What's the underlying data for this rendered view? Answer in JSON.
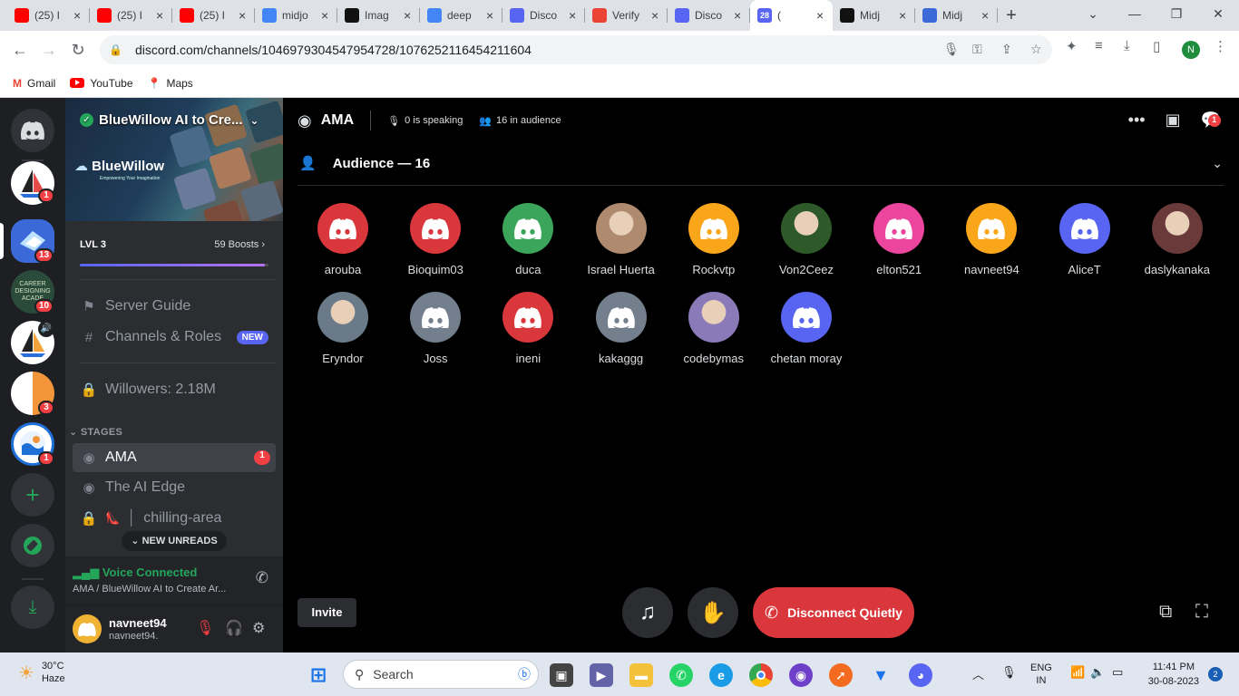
{
  "browser": {
    "tabs": [
      {
        "title": "(25) I",
        "icon": "youtube-icon",
        "color": "#ff0000"
      },
      {
        "title": "(25) I",
        "icon": "youtube-icon",
        "color": "#ff0000"
      },
      {
        "title": "(25) I",
        "icon": "youtube-icon",
        "color": "#ff0000"
      },
      {
        "title": "midjo",
        "icon": "google-icon",
        "color": "#4285f4"
      },
      {
        "title": "Imag",
        "icon": "image-site-icon",
        "color": "#111111"
      },
      {
        "title": "deep",
        "icon": "google-icon",
        "color": "#4285f4"
      },
      {
        "title": "Disco",
        "icon": "discord-icon",
        "color": "#5865f2"
      },
      {
        "title": "Verify",
        "icon": "gmail-icon",
        "color": "#ea4335"
      },
      {
        "title": "Disco",
        "icon": "discord-icon",
        "color": "#5865f2"
      },
      {
        "title": "(",
        "icon": "discord-icon",
        "color": "#5865f2",
        "active": true,
        "badge": "28"
      },
      {
        "title": "Midj",
        "icon": "midjourney-icon",
        "color": "#111111"
      },
      {
        "title": "Midj",
        "icon": "midjourney-icon",
        "color": "#3b6ad8"
      }
    ],
    "url": "discord.com/channels/1046979304547954728/1076252116454211604",
    "profile_initial": "N",
    "bookmarks": [
      {
        "label": "Gmail",
        "icon": "gmail-icon"
      },
      {
        "label": "YouTube",
        "icon": "youtube-icon"
      },
      {
        "label": "Maps",
        "icon": "maps-icon"
      }
    ]
  },
  "rail": {
    "servers": [
      {
        "name": "home",
        "badge": ""
      },
      {
        "name": "sailboat-server",
        "badge": "1"
      },
      {
        "name": "bluewillow-server",
        "badge": "13",
        "active": true
      },
      {
        "name": "career-designing-academy",
        "badge": "10",
        "text": "CAREER DESIGNING ACADE"
      },
      {
        "name": "sailboat-server-2",
        "badge": ""
      },
      {
        "name": "orange-server",
        "badge": "3"
      },
      {
        "name": "wave-server",
        "badge": "1"
      }
    ]
  },
  "server": {
    "name": "BlueWillow AI to Cre...",
    "logo_text": "BlueWillow",
    "logo_sub": "Empowering Your Imagination",
    "level": "LVL 3",
    "boosts": "59 Boosts",
    "boost_progress": 0.98,
    "server_guide": "Server Guide",
    "channels_roles": "Channels & Roles",
    "new_tag": "NEW",
    "willowers": "Willowers: 2.18M",
    "category": "STAGES",
    "channels": [
      {
        "name": "AMA",
        "badge": "1",
        "active": true
      },
      {
        "name": "The AI Edge"
      },
      {
        "name": "chilling-area"
      }
    ],
    "new_unreads": "NEW UNREADS"
  },
  "voice": {
    "status": "Voice Connected",
    "location": "AMA / BlueWillow AI to Create Ar..."
  },
  "user": {
    "name": "navneet94",
    "tag": "navneet94."
  },
  "stage": {
    "title": "AMA",
    "speaking": "0 is speaking",
    "audience_count": "16 in audience",
    "audience_header": "Audience — 16",
    "members": [
      {
        "name": "arouba",
        "color": "#da373c"
      },
      {
        "name": "Bioquim03",
        "color": "#da373c"
      },
      {
        "name": "duca",
        "color": "#3ba55c"
      },
      {
        "name": "Israel Huerta",
        "color": "#b08a6e",
        "photo": true
      },
      {
        "name": "Rockvtp",
        "color": "#faa61a"
      },
      {
        "name": "Von2Ceez",
        "color": "#2e5a2a",
        "photo": true
      },
      {
        "name": "elton521",
        "color": "#eb459e"
      },
      {
        "name": "navneet94",
        "color": "#faa61a"
      },
      {
        "name": "AliceT",
        "color": "#5865f2"
      },
      {
        "name": "daslykanaka",
        "color": "#6a3a3a",
        "photo": true
      },
      {
        "name": "Eryndor",
        "color": "#6a7a88",
        "photo": true
      },
      {
        "name": "Joss",
        "color": "#747f8d"
      },
      {
        "name": "ineni",
        "color": "#da373c"
      },
      {
        "name": "kakaggg",
        "color": "#747f8d"
      },
      {
        "name": "codebymas",
        "color": "#8a7ab8",
        "photo": true
      },
      {
        "name": "chetan moray",
        "color": "#5865f2"
      }
    ],
    "invite": "Invite",
    "disconnect": "Disconnect Quietly"
  },
  "taskbar": {
    "temp": "30°C",
    "weather": "Haze",
    "search": "Search",
    "lang1": "ENG",
    "lang2": "IN",
    "time": "11:41 PM",
    "date": "30-08-2023",
    "notifications": "2"
  }
}
